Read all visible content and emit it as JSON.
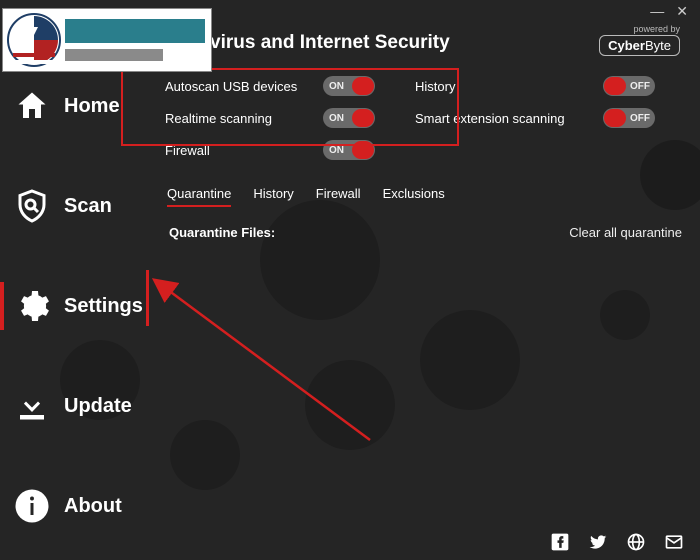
{
  "window": {
    "title": "virus and Internet Security"
  },
  "powered": {
    "label": "powered by",
    "brand_a": "Cyber",
    "brand_b": "Byte"
  },
  "sidebar": {
    "items": [
      {
        "label": "Home"
      },
      {
        "label": "Scan"
      },
      {
        "label": "Settings"
      },
      {
        "label": "Update"
      },
      {
        "label": "About"
      }
    ]
  },
  "toggles": {
    "left": [
      {
        "label": "Autoscan USB devices",
        "state": "ON"
      },
      {
        "label": "Realtime scanning",
        "state": "ON"
      },
      {
        "label": "Firewall",
        "state": "ON"
      }
    ],
    "right": [
      {
        "label": "History",
        "state": "OFF"
      },
      {
        "label": "Smart extension scanning",
        "state": "OFF"
      }
    ]
  },
  "tabs": [
    {
      "label": "Quarantine"
    },
    {
      "label": "History"
    },
    {
      "label": "Firewall"
    },
    {
      "label": "Exclusions"
    }
  ],
  "quarantine": {
    "heading": "Quarantine Files:",
    "clear_label": "Clear all quarantine"
  },
  "colors": {
    "accent": "#d41f1f",
    "bg": "#252525"
  }
}
